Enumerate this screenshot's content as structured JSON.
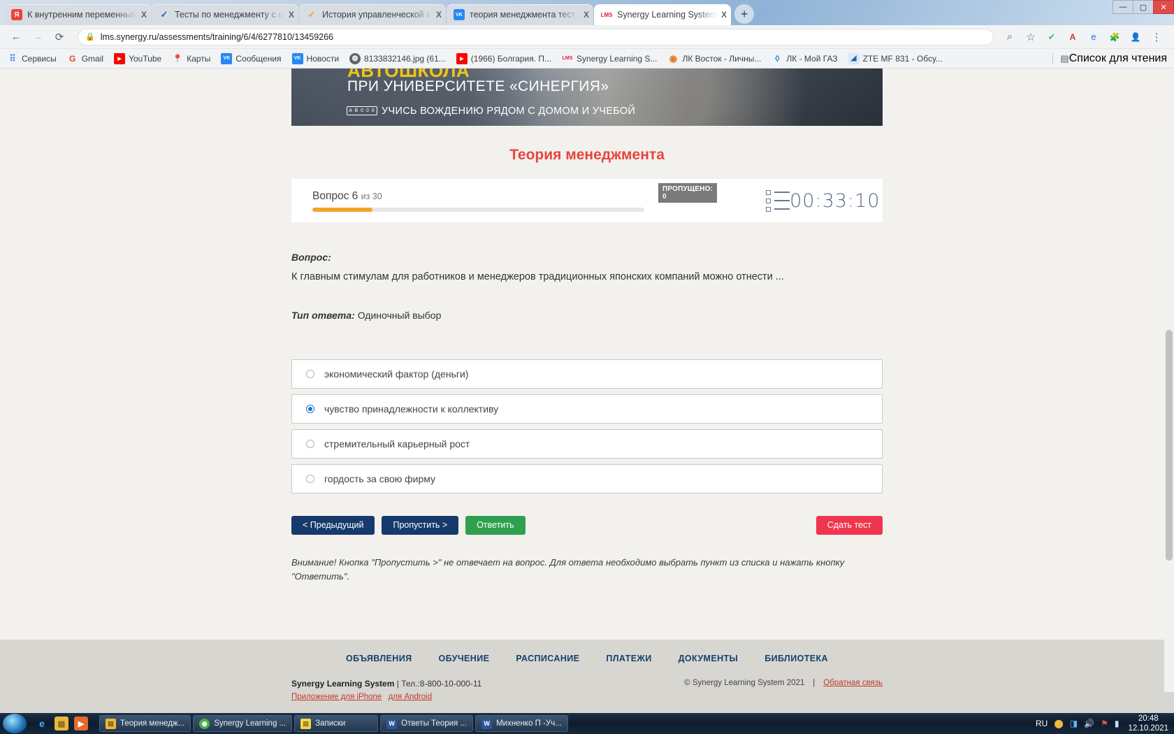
{
  "browser": {
    "tabs": [
      {
        "title": "К внутренним переменным орг",
        "favicon": "yandex-icon",
        "favicon_char": "Я",
        "favicon_color": "#e8453c",
        "active": false
      },
      {
        "title": "Тесты по менеджменту с ответа",
        "favicon": "checkmark-icon",
        "favicon_char": "✓",
        "favicon_color": "#2b5fa8",
        "active": false
      },
      {
        "title": "История управленческой мысл",
        "favicon": "checkmark-icon",
        "favicon_char": "✓",
        "favicon_color": "#f0a42a",
        "active": false
      },
      {
        "title": "теория менеджмента тест для с",
        "favicon": "vk-icon",
        "favicon_char": "VK",
        "favicon_color": "#2787f5",
        "active": false
      },
      {
        "title": "Synergy Learning System",
        "favicon": "lms-icon",
        "favicon_char": "LMS",
        "favicon_color": "#e8173d",
        "active": true
      }
    ],
    "new_tab_label": "+",
    "close_label": "X",
    "window_controls": {
      "minimize": "—",
      "maximize": "▢",
      "close": "✕"
    },
    "nav": {
      "back": "←",
      "forward": "→",
      "reload": "⟳",
      "lock": "🔒",
      "url": "lms.synergy.ru/assessments/training/6/4/6277810/13459266",
      "zoom": "⌕",
      "star": "☆",
      "ext_shield": "✔",
      "ext_pdf": "A",
      "ext_blue": "e",
      "ext_puzzle": "🧩",
      "profile": "👤",
      "menu": "⋮"
    },
    "bookmarks": [
      {
        "label": "Сервисы",
        "icon": "apps-grid-icon",
        "char": "⠿",
        "color": "#ffffff",
        "text_color": "#4285f4"
      },
      {
        "label": "Gmail",
        "icon": "gmail-icon",
        "char": "G",
        "color": "#ffffff",
        "text_color": "#ea4335"
      },
      {
        "label": "YouTube",
        "icon": "youtube-icon",
        "char": "▶",
        "color": "#ff0000",
        "text_color": "#ffffff"
      },
      {
        "label": "Карты",
        "icon": "maps-pin-icon",
        "char": "📍",
        "color": "#ffffff",
        "text_color": "#34a853"
      },
      {
        "label": "Сообщения",
        "icon": "vk-icon",
        "char": "VK",
        "color": "#2787f5",
        "text_color": "#ffffff"
      },
      {
        "label": "Новости",
        "icon": "vk-icon",
        "char": "VK",
        "color": "#2787f5",
        "text_color": "#ffffff"
      },
      {
        "label": "8133832146.jpg (61...",
        "icon": "globe-icon",
        "char": "◍",
        "color": "#5f6368",
        "text_color": "#ffffff"
      },
      {
        "label": "(1966) Болгария. П...",
        "icon": "youtube-icon",
        "char": "▶",
        "color": "#ff0000",
        "text_color": "#ffffff"
      },
      {
        "label": "Synergy Learning S...",
        "icon": "lms-icon",
        "char": "LMS",
        "color": "#ffffff",
        "text_color": "#e8173d"
      },
      {
        "label": "ЛК Восток - Личны...",
        "icon": "vostok-icon",
        "char": "◉",
        "color": "#ffffff",
        "text_color": "#e07b2a"
      },
      {
        "label": "ЛК - Мой ГАЗ",
        "icon": "gas-drop-icon",
        "char": "◊",
        "color": "#ffffff",
        "text_color": "#0a84c8"
      },
      {
        "label": "ZTE MF 831 - Обсу...",
        "icon": "zte-icon",
        "char": "◢",
        "color": "#dce8f5",
        "text_color": "#1a5fa8"
      }
    ],
    "reading_list": {
      "label": "Список для чтения",
      "icon": "reading-list-icon",
      "char": "▤"
    }
  },
  "page": {
    "banner": {
      "line1": "АВТОШКОЛА",
      "line2": "ПРИ УНИВЕРСИТЕТЕ «СИНЕРГИЯ»",
      "line3": "УЧИСЬ ВОЖДЕНИЮ РЯДОМ С ДОМОМ И УЧЕБОЙ",
      "plate": "A B 0 0 0"
    },
    "title": "Теория менеджмента",
    "status": {
      "question_label": "Вопрос 6",
      "question_of": "из 30",
      "progress_percent": 18,
      "skipped_badge": "ПРОПУЩЕНО: 0",
      "list_icon": "list-view-icon",
      "timer": "00:33:10"
    },
    "question": {
      "label": "Вопрос:",
      "text": "К главным стимулам для работников и менеджеров традиционных японских компаний можно отнести ...",
      "answer_type_label": "Тип ответа:",
      "answer_type_value": "Одиночный выбор"
    },
    "options": [
      {
        "text": "экономический фактор (деньги)",
        "selected": false
      },
      {
        "text": "чувство принадлежности к коллективу",
        "selected": true
      },
      {
        "text": "стремительный карьерный рост",
        "selected": false
      },
      {
        "text": "гордость за свою фирму",
        "selected": false
      }
    ],
    "buttons": {
      "prev": "< Предыдущий",
      "skip": "Пропустить >",
      "answer": "Ответить",
      "submit": "Сдать тест"
    },
    "notice": "Внимание! Кнопка \"Пропустить >\" не отвечает на вопрос. Для ответа необходимо выбрать пункт из списка и нажать кнопку \"Ответить\".",
    "footer": {
      "nav": [
        "ОБЪЯВЛЕНИЯ",
        "ОБУЧЕНИЕ",
        "РАСПИСАНИЕ",
        "ПЛАТЕЖИ",
        "ДОКУМЕНТЫ",
        "БИБЛИОТЕКА"
      ],
      "brand": "Synergy Learning System",
      "phone_sep": "|",
      "phone": "Тел.:8-800-10-000-11",
      "app_iphone": "Приложение для iPhone",
      "app_android": "для Android",
      "copyright": "© Synergy Learning System 2021",
      "copy_sep": "|",
      "feedback": "Обратная связь"
    }
  },
  "taskbar": {
    "items": [
      {
        "label": "Теория менедж...",
        "icon": "folder-icon",
        "char": "▤",
        "color": "#e8b93d"
      },
      {
        "label": "Synergy Learning ...",
        "icon": "chrome-icon",
        "char": "◉",
        "color": "#4caf50"
      },
      {
        "label": "Записки",
        "icon": "notes-icon",
        "char": "▤",
        "color": "#f2d64b"
      },
      {
        "label": "Ответы Теория ...",
        "icon": "word-icon",
        "char": "W",
        "color": "#2b579a"
      },
      {
        "label": "Михненко П -Уч...",
        "icon": "word-icon",
        "char": "W",
        "color": "#2b579a"
      }
    ],
    "quick_launch": [
      {
        "icon": "ie-icon",
        "char": "e",
        "color": "#1a6fb5"
      },
      {
        "icon": "explorer-icon",
        "char": "▤",
        "color": "#e8b93d"
      },
      {
        "icon": "media-player-icon",
        "char": "▶",
        "color": "#e06a2a"
      }
    ],
    "tray": {
      "language": "RU",
      "icons": [
        "shield-icon",
        "network-icon",
        "volume-icon",
        "flag-icon",
        "signal-icon"
      ],
      "time": "20:48",
      "date": "12.10.2021"
    }
  }
}
